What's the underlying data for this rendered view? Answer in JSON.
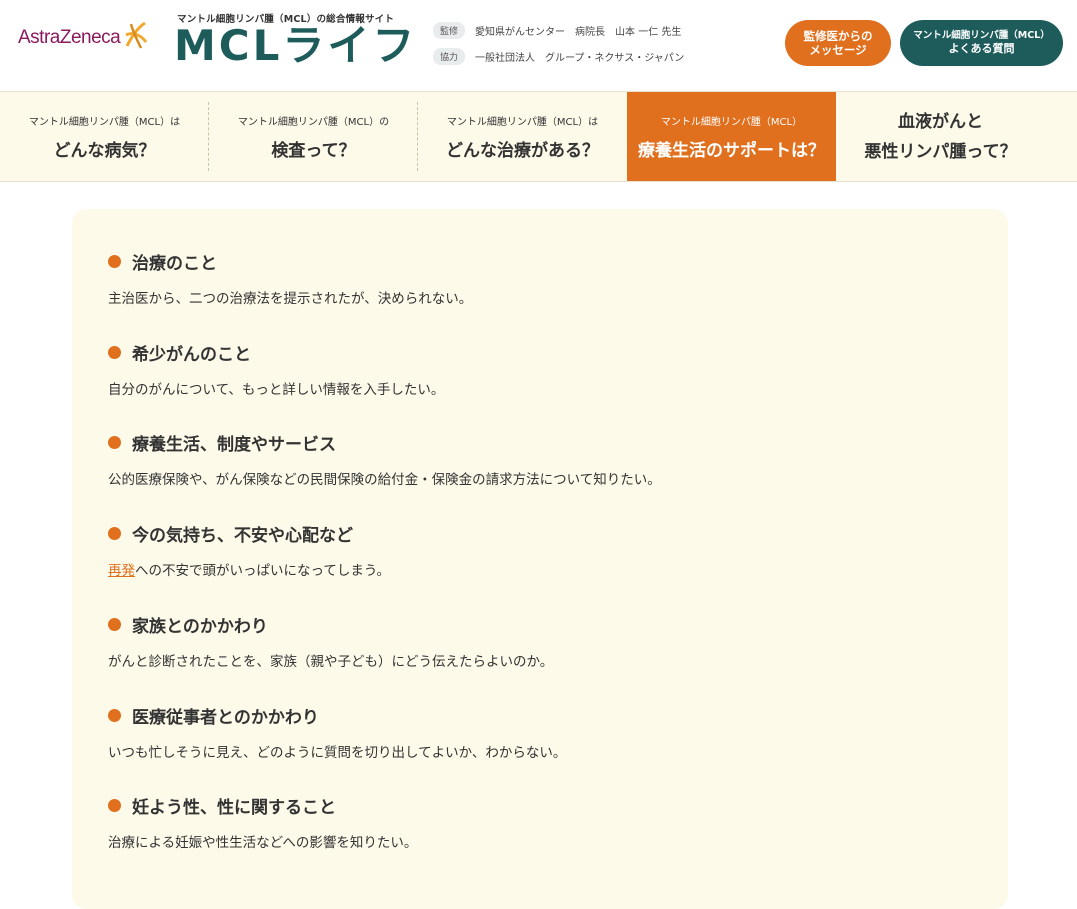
{
  "header": {
    "logo_text": "AstraZeneca",
    "site_subtitle": "マントル細胞リンパ腫（MCL）の総合情報サイト",
    "site_title": "MCLライフ",
    "supervision_tag": "監修",
    "supervision_text": "愛知県がんセンター　病院長　山本 一仁 先生",
    "cooperation_tag": "協力",
    "cooperation_text": "一般社団法人　グループ・ネクサス・ジャパン",
    "btn_message_line1": "監修医からの",
    "btn_message_line2": "メッセージ",
    "btn_faq_line1": "マントル細胞リンパ腫（MCL）",
    "btn_faq_line2": "よくある質問"
  },
  "nav": [
    {
      "small": "マントル細胞リンパ腫（MCL）は",
      "big": "どんな病気？"
    },
    {
      "small": "マントル細胞リンパ腫（MCL）の",
      "big": "検査って？"
    },
    {
      "small": "マントル細胞リンパ腫（MCL）は",
      "big": "どんな治療がある？"
    },
    {
      "small": "マントル細胞リンパ腫（MCL）",
      "big": "療養生活のサポートは？"
    },
    {
      "line1": "血液がんと",
      "line2": "悪性リンパ腫って？"
    }
  ],
  "topics": [
    {
      "title": "治療のこと",
      "desc": "主治医から、二つの治療法を提示されたが、決められない。"
    },
    {
      "title": "希少がんのこと",
      "desc": "自分のがんについて、もっと詳しい情報を入手したい。"
    },
    {
      "title": "療養生活、制度やサービス",
      "desc": "公的医療保険や、がん保険などの民間保険の給付金・保険金の請求方法について知りたい。"
    },
    {
      "title": "今の気持ち、不安や心配など",
      "desc_link": "再発",
      "desc": "への不安で頭がいっぱいになってしまう。"
    },
    {
      "title": "家族とのかかわり",
      "desc": "がんと診断されたことを、家族（親や子ども）にどう伝えたらよいのか。"
    },
    {
      "title": "医療従事者とのかかわり",
      "desc": "いつも忙しそうに見え、どのように質問を切り出してよいか、わからない。"
    },
    {
      "title": "妊よう性、性に関すること",
      "desc": "治療による妊娠や性生活などへの影響を知りたい。"
    }
  ],
  "colors": {
    "accent": "#e0701e",
    "brand": "#1e5c5c",
    "nav_bg": "#fdfaea",
    "logo": "#8a1a5e"
  }
}
